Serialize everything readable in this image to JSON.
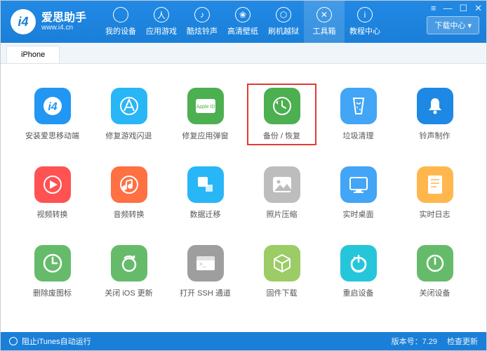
{
  "header": {
    "brand_name": "爱思助手",
    "brand_url": "www.i4.cn",
    "download_label": "下载中心",
    "nav": [
      {
        "label": "我的设备"
      },
      {
        "label": "应用游戏"
      },
      {
        "label": "酷炫铃声"
      },
      {
        "label": "高清壁纸"
      },
      {
        "label": "刷机越狱"
      },
      {
        "label": "工具箱"
      },
      {
        "label": "教程中心"
      }
    ]
  },
  "tab": {
    "label": "iPhone"
  },
  "tools": [
    {
      "label": "安装爱思移动端",
      "color": "#2196f3"
    },
    {
      "label": "修复游戏闪退",
      "color": "#29b6f6"
    },
    {
      "label": "修复应用弹窗",
      "color": "#4caf50"
    },
    {
      "label": "备份 / 恢复",
      "color": "#4caf50",
      "highlighted": true
    },
    {
      "label": "垃圾清理",
      "color": "#42a5f5"
    },
    {
      "label": "铃声制作",
      "color": "#1e88e5"
    },
    {
      "label": "视频转换",
      "color": "#ff5252"
    },
    {
      "label": "音频转换",
      "color": "#ff7043"
    },
    {
      "label": "数据迁移",
      "color": "#29b6f6"
    },
    {
      "label": "照片压缩",
      "color": "#bdbdbd"
    },
    {
      "label": "实时桌面",
      "color": "#42a5f5"
    },
    {
      "label": "实时日志",
      "color": "#ffb74d"
    },
    {
      "label": "删除废图标",
      "color": "#66bb6a"
    },
    {
      "label": "关闭 iOS 更新",
      "color": "#66bb6a"
    },
    {
      "label": "打开 SSH 通道",
      "color": "#9e9e9e"
    },
    {
      "label": "固件下载",
      "color": "#9ccc65"
    },
    {
      "label": "重启设备",
      "color": "#26c6da"
    },
    {
      "label": "关闭设备",
      "color": "#66bb6a"
    }
  ],
  "footer": {
    "itunes": "阻止iTunes自动运行",
    "version": "版本号：7.29",
    "check_update": "检查更新"
  }
}
